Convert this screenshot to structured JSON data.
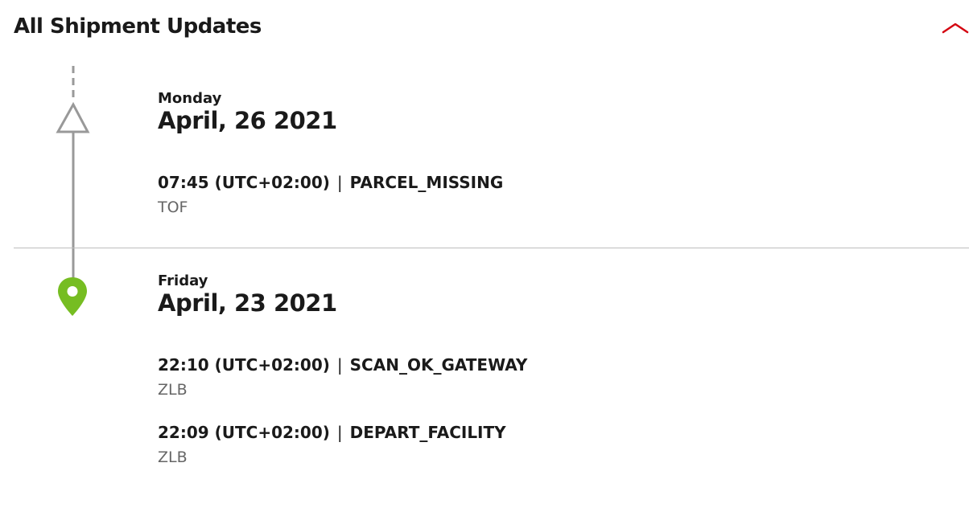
{
  "header": {
    "title": "All Shipment Updates",
    "collapse_icon": "chevron-up-icon",
    "accent_color": "#d40511"
  },
  "timeline": {
    "line_color": "#999999",
    "current_marker_icon": "map-pin-icon",
    "current_marker_color": "#76bd22",
    "past_marker_icon": "triangle-outline-icon"
  },
  "days": [
    {
      "day_name": "Monday",
      "date": "April, 26 2021",
      "events": [
        {
          "time": "07:45 (UTC+02:00)",
          "separator": "|",
          "status": "PARCEL_MISSING",
          "location": "TOF"
        }
      ]
    },
    {
      "day_name": "Friday",
      "date": "April, 23 2021",
      "events": [
        {
          "time": "22:10 (UTC+02:00)",
          "separator": "|",
          "status": "SCAN_OK_GATEWAY",
          "location": "ZLB"
        },
        {
          "time": "22:09 (UTC+02:00)",
          "separator": "|",
          "status": "DEPART_FACILITY",
          "location": "ZLB"
        }
      ]
    }
  ]
}
